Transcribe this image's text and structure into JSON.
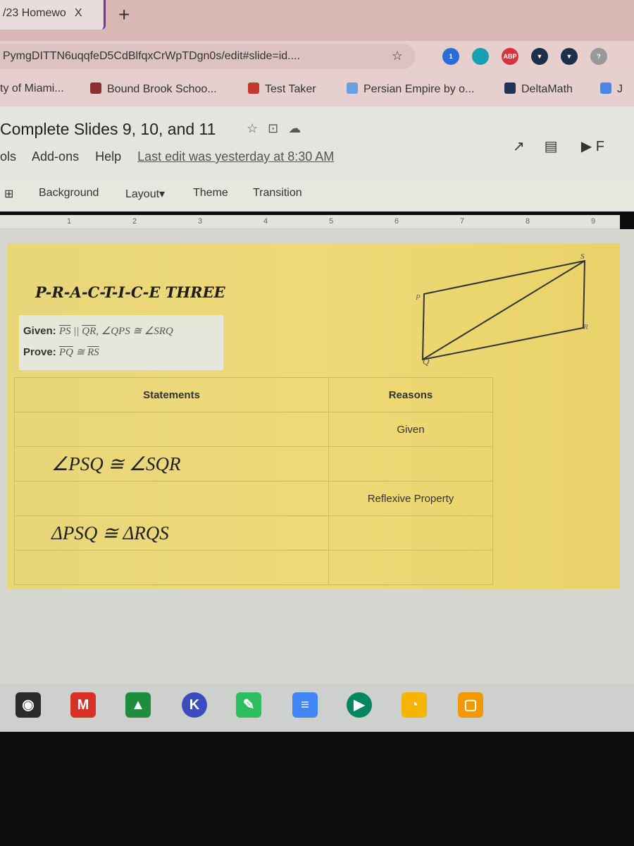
{
  "browser": {
    "tab_title": "/23 Homewo",
    "tab_close": "X",
    "new_tab": "+",
    "url": "PymgDITTN6uqqfeD5CdBlfqxCrWpTDgn0s/edit#slide=id....",
    "bookmark_star": "☆",
    "extensions": [
      {
        "name": "ext-badge",
        "label": "1",
        "color": "#2a6fd6"
      },
      {
        "name": "ext-cyan",
        "label": "",
        "color": "#1a9fb0"
      },
      {
        "name": "adblock-plus",
        "label": "ABP",
        "color": "#d9333f"
      },
      {
        "name": "ext-vpn",
        "label": "▼",
        "color": "#1e2f4a"
      },
      {
        "name": "ext-vpn2",
        "label": "▼",
        "color": "#1e2f4a"
      },
      {
        "name": "ext-help",
        "label": "?",
        "color": "#999999"
      }
    ],
    "bookmarks": [
      {
        "label": "ty of Miami...",
        "icon": "none"
      },
      {
        "label": "Bound Brook Schoo...",
        "icon": "school-icon"
      },
      {
        "label": "Test Taker",
        "icon": "test-taker-icon"
      },
      {
        "label": "Persian Empire by o...",
        "icon": "globe-icon"
      },
      {
        "label": "DeltaMath",
        "icon": "deltamath-icon"
      },
      {
        "label": "J",
        "icon": "docs-icon"
      }
    ]
  },
  "doc": {
    "title": "Complete Slides 9, 10, and 11",
    "menus": [
      "ols",
      "Add-ons",
      "Help"
    ],
    "last_edit": "Last edit was yesterday at 8:30 AM",
    "present": "F"
  },
  "toolbar": {
    "items": [
      "Background",
      "Layout▾",
      "Theme",
      "Transition"
    ]
  },
  "ruler": [
    "1",
    "2",
    "3",
    "4",
    "5",
    "6",
    "7",
    "8",
    "9"
  ],
  "slide": {
    "heading": "P-R-A-C-T-I-C-E THREE",
    "given_label": "Given:",
    "given_seg1": "PS",
    "given_par": " || ",
    "given_seg2": "QR",
    "given_rest": ",  ∠QPS ≅ ∠SRQ",
    "prove_label": "Prove:",
    "prove_seg1": "PQ",
    "prove_cong": " ≅ ",
    "prove_seg2": "RS",
    "table": {
      "headers": [
        "Statements",
        "Reasons"
      ],
      "rows": [
        [
          "",
          "Given"
        ],
        [
          "∠PSQ ≅ ∠SQR",
          ""
        ],
        [
          "",
          "Reflexive Property"
        ],
        [
          "ΔPSQ ≅ ΔRQS",
          ""
        ],
        [
          "",
          ""
        ]
      ]
    },
    "diagram_labels": {
      "P": "P",
      "Q": "Q",
      "R": "R",
      "S": "S"
    }
  },
  "taskbar": {
    "apps": [
      {
        "name": "camera",
        "label": "◉",
        "color": "#2b2b2b"
      },
      {
        "name": "gmail",
        "label": "M",
        "color": "#d93025"
      },
      {
        "name": "drive",
        "label": "▲",
        "color": "#1e8e3e"
      },
      {
        "name": "kami",
        "label": "K",
        "color": "#3b4cc0"
      },
      {
        "name": "evernote",
        "label": "✎",
        "color": "#2dbe60"
      },
      {
        "name": "docs",
        "label": "≡",
        "color": "#4285f4"
      },
      {
        "name": "play-store",
        "label": "▶",
        "color": "#01875f"
      },
      {
        "name": "chrome-app",
        "label": "◔",
        "color": "#f4b400"
      },
      {
        "name": "files",
        "label": "▢",
        "color": "#f29900"
      }
    ]
  }
}
